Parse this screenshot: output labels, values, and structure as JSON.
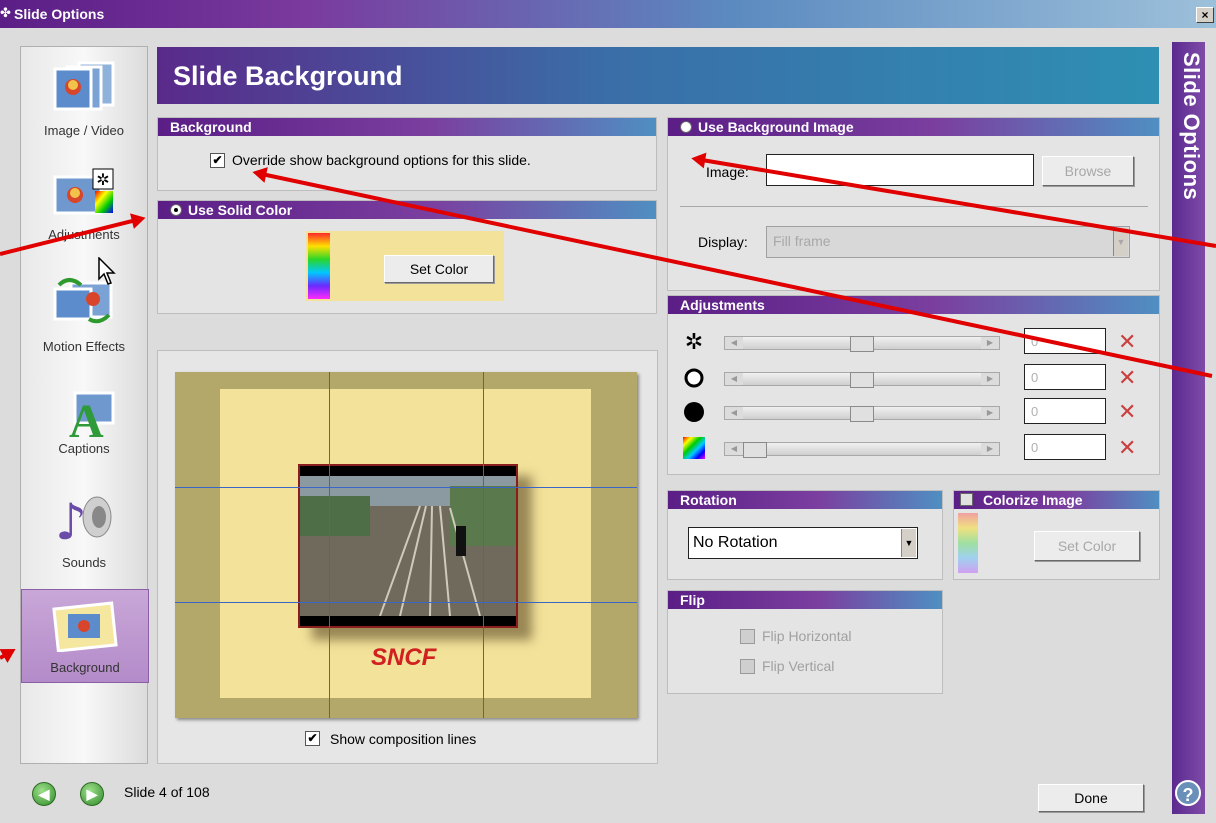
{
  "window": {
    "title": "Slide Options",
    "close_glyph": "×"
  },
  "sidebar": {
    "items": [
      {
        "label": "Image / Video",
        "icon": "image-video-icon"
      },
      {
        "label": "Adjustments",
        "icon": "adjustments-icon"
      },
      {
        "label": "Motion Effects",
        "icon": "motion-effects-icon"
      },
      {
        "label": "Captions",
        "icon": "captions-icon"
      },
      {
        "label": "Sounds",
        "icon": "sounds-icon"
      },
      {
        "label": "Background",
        "icon": "background-icon",
        "selected": true
      }
    ]
  },
  "header": {
    "title": "Slide Background"
  },
  "background_section": {
    "title": "Background",
    "override_label": "Override show background options for this slide.",
    "override_checked": true
  },
  "solid_color": {
    "title": "Use Solid Color",
    "selected": true,
    "button": "Set Color"
  },
  "bg_image": {
    "title": "Use Background Image",
    "selected": false,
    "image_label": "Image:",
    "image_value": "",
    "browse": "Browse",
    "display_label": "Display:",
    "display_value": "Fill frame"
  },
  "adjustments": {
    "title": "Adjustments",
    "rows": [
      {
        "icon": "brightness-icon",
        "value": "0",
        "level": 0.5
      },
      {
        "icon": "contrast-white-circle-icon",
        "value": "0",
        "level": 0.5
      },
      {
        "icon": "black-circle-icon",
        "value": "0",
        "level": 0.5
      },
      {
        "icon": "hue-icon",
        "value": "0",
        "level": 0.0
      }
    ]
  },
  "rotation": {
    "title": "Rotation",
    "value": "No Rotation"
  },
  "colorize": {
    "title": "Colorize Image",
    "checked": false,
    "button": "Set Color"
  },
  "flip": {
    "title": "Flip",
    "horizontal": "Flip Horizontal",
    "vertical": "Flip Vertical"
  },
  "preview": {
    "caption": "SNCF",
    "show_lines_label": "Show composition lines",
    "show_lines_checked": true
  },
  "right_strip": {
    "title": "Slide Options"
  },
  "footer": {
    "slide_status": "Slide 4 of 108",
    "done": "Done",
    "help": "?"
  },
  "colors": {
    "accent_purple": "#5a1e86",
    "accent_blue": "#2e8fb3",
    "annotation_red": "#e00000"
  }
}
